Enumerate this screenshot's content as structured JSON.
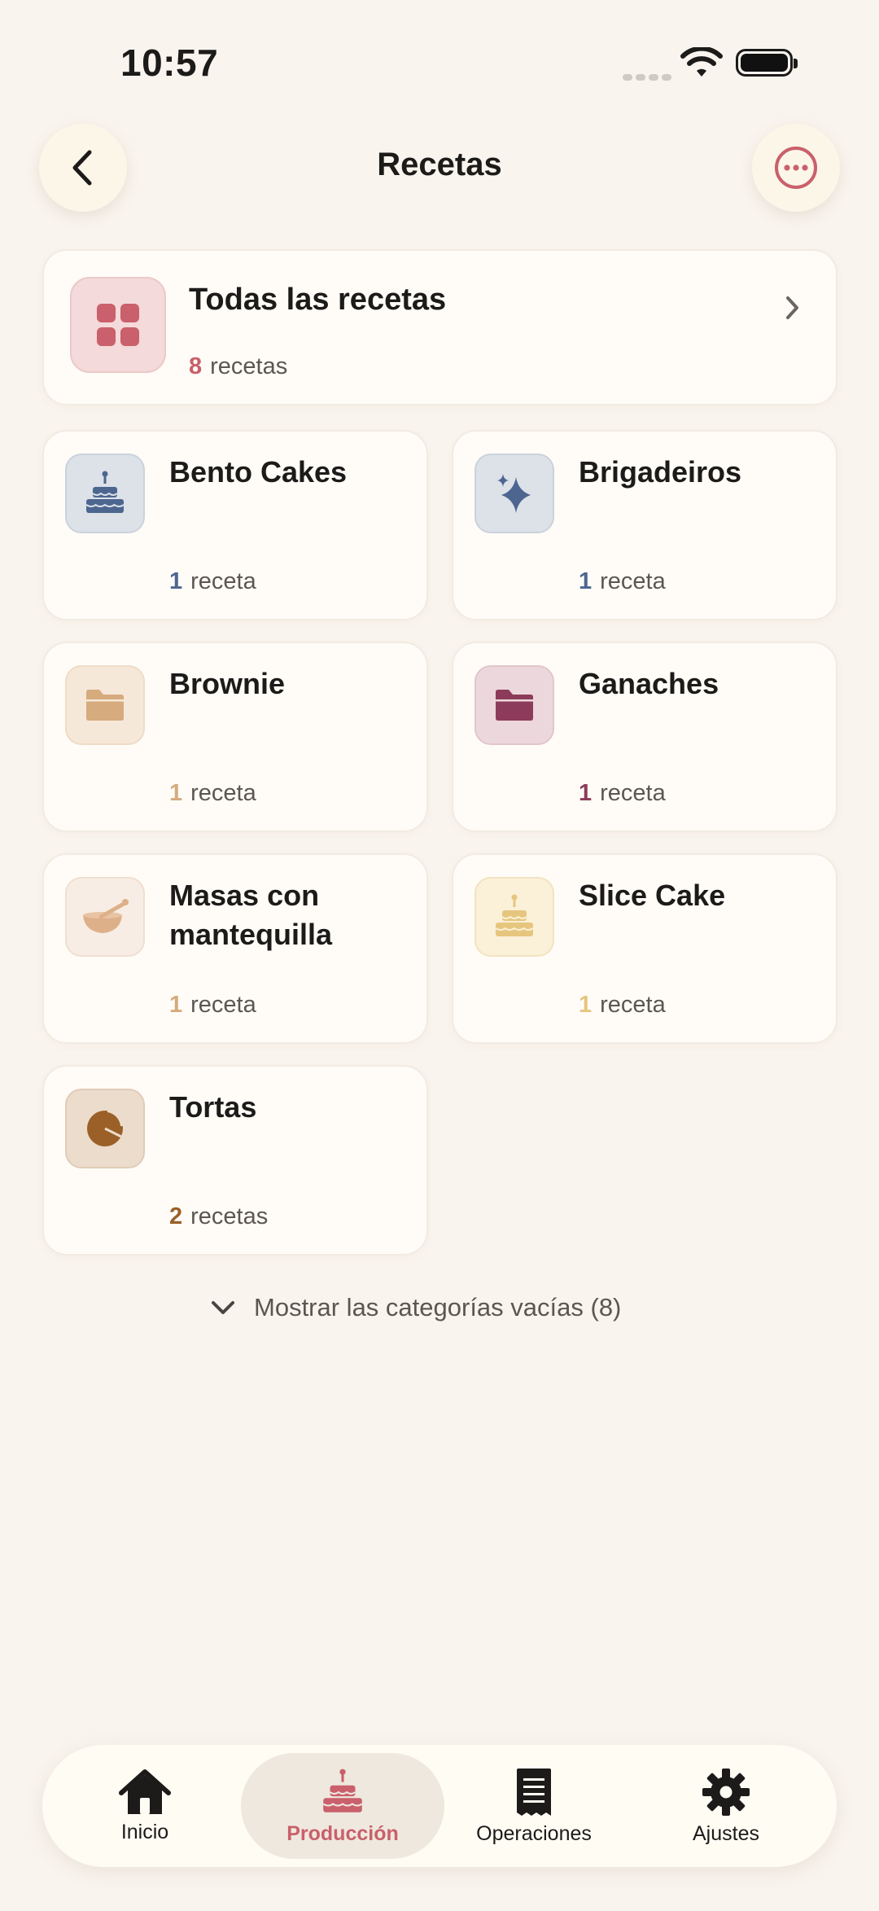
{
  "status": {
    "time": "10:57"
  },
  "header": {
    "title": "Recetas"
  },
  "all_recipes": {
    "title": "Todas las recetas",
    "count": "8",
    "unit": "recetas",
    "icon": "grid-icon",
    "accent": "#c9606b"
  },
  "categories": [
    {
      "title": "Bento Cakes",
      "count": "1",
      "unit": "receta",
      "icon": "cake-icon",
      "accent": "#4c6690"
    },
    {
      "title": "Brigadeiros",
      "count": "1",
      "unit": "receta",
      "icon": "sparkle-icon",
      "accent": "#4c6690"
    },
    {
      "title": "Brownie",
      "count": "1",
      "unit": "receta",
      "icon": "folder-icon",
      "accent": "#d6ab7d"
    },
    {
      "title": "Ganaches",
      "count": "1",
      "unit": "receta",
      "icon": "folder-icon",
      "accent": "#8c3c5a"
    },
    {
      "title": "Masas con mantequilla",
      "count": "1",
      "unit": "receta",
      "icon": "mixing-bowl-icon",
      "accent": "#d6ab7d"
    },
    {
      "title": "Slice Cake",
      "count": "1",
      "unit": "receta",
      "icon": "cake-icon",
      "accent": "#e6c67f"
    },
    {
      "title": "Tortas",
      "count": "2",
      "unit": "recetas",
      "icon": "pie-chart-icon",
      "accent": "#9a6028"
    }
  ],
  "empty_toggle": {
    "label": "Mostrar las categorías vacías (8)"
  },
  "tabbar": {
    "tabs": [
      {
        "label": "Inicio",
        "icon": "home-icon"
      },
      {
        "label": "Producción",
        "icon": "cake-icon",
        "active": true
      },
      {
        "label": "Operaciones",
        "icon": "receipt-icon"
      },
      {
        "label": "Ajustes",
        "icon": "gear-icon"
      }
    ]
  }
}
